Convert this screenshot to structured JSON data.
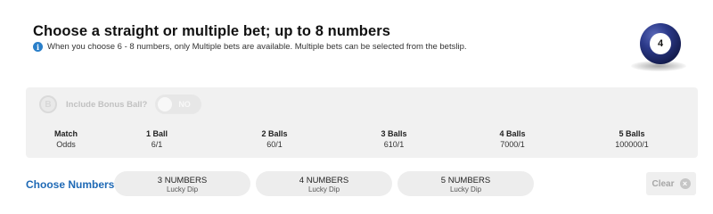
{
  "header": {
    "title": "Choose a straight or multiple bet; up to 8 numbers",
    "info_icon_text": "i",
    "info_text": "When you choose 6 - 8 numbers, only Multiple bets are available. Multiple bets can be selected from the betslip.",
    "ball_number": "4",
    "ball_icon": "lottery-ball-icon"
  },
  "bonus": {
    "icon_letter": "B",
    "label": "Include Bonus Ball?",
    "toggle_text": "NO",
    "toggle_on": false
  },
  "odds_table": {
    "columns": [
      {
        "head": "Match",
        "value": "Odds"
      },
      {
        "head": "1 Ball",
        "value": "6/1"
      },
      {
        "head": "2 Balls",
        "value": "60/1"
      },
      {
        "head": "3 Balls",
        "value": "610/1"
      },
      {
        "head": "4 Balls",
        "value": "7000/1"
      },
      {
        "head": "5 Balls",
        "value": "100000/1"
      }
    ]
  },
  "choose": {
    "label": "Choose Numbers",
    "buttons": [
      {
        "main": "3 NUMBERS",
        "sub": "Lucky Dip"
      },
      {
        "main": "4 NUMBERS",
        "sub": "Lucky Dip"
      },
      {
        "main": "5 NUMBERS",
        "sub": "Lucky Dip"
      }
    ],
    "clear_label": "Clear",
    "clear_icon": "×"
  },
  "colors": {
    "accent": "#1e69b5",
    "info": "#2a7fc9",
    "ball": "#1f2a6b"
  }
}
